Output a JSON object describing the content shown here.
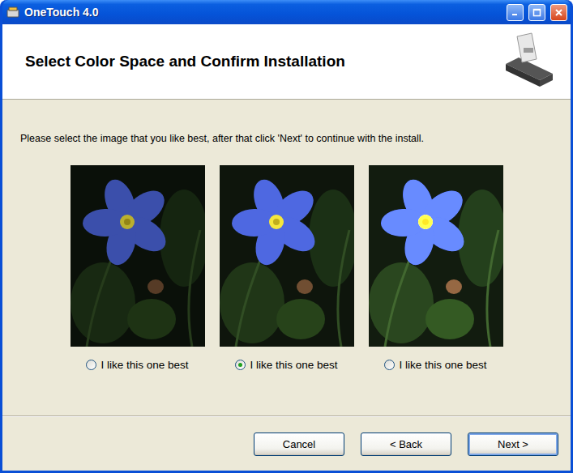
{
  "window": {
    "title": "OneTouch 4.0"
  },
  "header": {
    "title": "Select Color Space and Confirm Installation"
  },
  "instruction": "Please select the image that you like best, after that click 'Next' to continue with the install.",
  "options": [
    {
      "label": "I like this one best",
      "selected": false
    },
    {
      "label": "I like this one best",
      "selected": true
    },
    {
      "label": "I like this one best",
      "selected": false
    }
  ],
  "buttons": [
    {
      "label": "Cancel",
      "default": false
    },
    {
      "label": "< Back",
      "default": false
    },
    {
      "label": "Next >",
      "default": true
    }
  ]
}
